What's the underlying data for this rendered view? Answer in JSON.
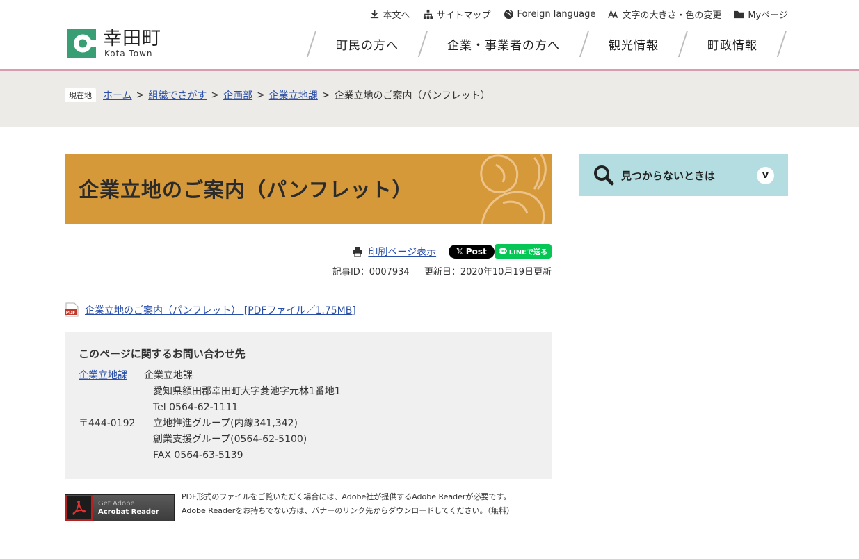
{
  "header": {
    "site_name": "幸田町",
    "site_name_en": "Kota Town",
    "utility": [
      {
        "label": "本文へ",
        "icon": "download-icon"
      },
      {
        "label": "サイトマップ",
        "icon": "sitemap-icon"
      },
      {
        "label": "Foreign language",
        "icon": "globe-icon"
      },
      {
        "label": "文字の大きさ・色の変更",
        "icon": "text-size-icon"
      },
      {
        "label": "Myページ",
        "icon": "folder-icon"
      }
    ],
    "nav": [
      "町民の方へ",
      "企業・事業者の方へ",
      "観光情報",
      "町政情報"
    ]
  },
  "breadcrumb": {
    "here_label": "現在地",
    "items": [
      "ホーム",
      "組織でさがす",
      "企画部",
      "企業立地課"
    ],
    "current": "企業立地のご案内（パンフレット）",
    "separator": ">"
  },
  "main": {
    "title": "企業立地のご案内（パンフレット）",
    "print_label": "印刷ページ表示",
    "x_post_label": "Post",
    "line_label": "LINEで送る",
    "article_id": "記事ID：0007934",
    "updated": "更新日：2020年10月19日更新",
    "pdf_link": "企業立地のご案内（パンフレット） [PDFファイル／1.75MB]"
  },
  "contact": {
    "heading": "このページに関するお問い合わせ先",
    "dept_link": "企業立地課",
    "dept_name": "企業立地課",
    "address": "愛知県額田郡幸田町大字菱池字元林1番地1",
    "tel": "Tel 0564-62-1111",
    "postal": "〒444-0192",
    "group1": "立地推進グループ(内線341,342)",
    "group2": "創業支援グループ(0564-62-5100)",
    "fax": "FAX 0564-63-5139"
  },
  "adobe": {
    "banner_line1": "Get Adobe",
    "banner_line2": "Acrobat Reader",
    "text_line1": "PDF形式のファイルをご覧いただく場合には、Adobe社が提供するAdobe Readerが必要です。",
    "text_line2": "Adobe Readerをお持ちでない方は、バナーのリンク先からダウンロードしてください。（無料）"
  },
  "side": {
    "label": "見つからないときは",
    "chevron": "v"
  },
  "colors": {
    "accent_pink": "#d99bb0",
    "title_band": "#d6993a",
    "side_panel": "#b3dde0",
    "breadcrumb_bg": "#ecebe7",
    "contact_bg": "#f0f0f0"
  }
}
